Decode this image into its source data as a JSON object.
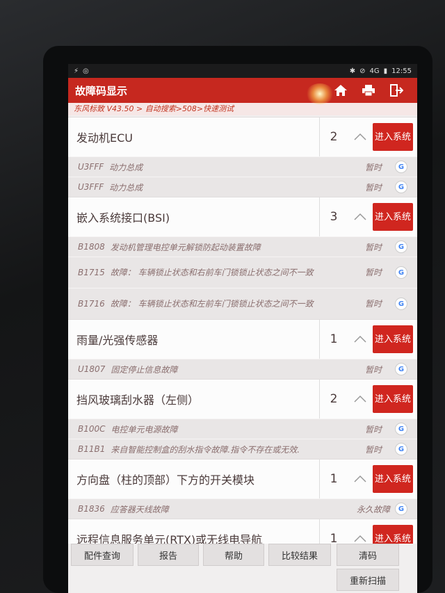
{
  "statusbar": {
    "time": "12:55",
    "signal": "4G"
  },
  "topbar": {
    "title": "故障码显示"
  },
  "breadcrumb": "东风标致 V43.50 > 自动搜索>508>快速测试",
  "systems": [
    {
      "name": "发动机ECU",
      "count": "2",
      "enter_label": "进入系统",
      "dtcs": [
        {
          "code": "U3FFF",
          "desc": "动力总成",
          "status": "暂时"
        },
        {
          "code": "U3FFF",
          "desc": "动力总成",
          "status": "暂时"
        }
      ]
    },
    {
      "name": "嵌入系统接口(BSI)",
      "count": "3",
      "enter_label": "进入系统",
      "dtcs": [
        {
          "code": "B1808",
          "desc": "发动机管理电控单元解锁防起动装置故障",
          "status": "暂时"
        },
        {
          "code": "B1715",
          "desc": "故障： 车辆锁止状态和右前车门锁锁止状态之间不一致",
          "status": "暂时"
        },
        {
          "code": "B1716",
          "desc": "故障： 车辆锁止状态和左前车门锁锁止状态之间不一致",
          "status": "暂时"
        }
      ]
    },
    {
      "name": "雨量/光强传感器",
      "count": "1",
      "enter_label": "进入系统",
      "dtcs": [
        {
          "code": "U1807",
          "desc": "固定停止信息故障",
          "status": "暂时"
        }
      ]
    },
    {
      "name": "挡风玻璃刮水器（左侧）",
      "count": "2",
      "enter_label": "进入系统",
      "dtcs": [
        {
          "code": "B100C",
          "desc": "电控单元电源故障",
          "status": "暂时"
        },
        {
          "code": "B11B1",
          "desc": "来自智能控制盒的刮水指令故障.指令不存在或无效.",
          "status": "暂时"
        }
      ]
    },
    {
      "name": "方向盘（柱的顶部）下方的开关模块",
      "count": "1",
      "enter_label": "进入系统",
      "dtcs": [
        {
          "code": "B1836",
          "desc": "应答器天线故障",
          "status": "永久故障"
        }
      ]
    },
    {
      "name": "远程信息服务单元(RTX)或无线电导航",
      "count": "1",
      "enter_label": "进入系统",
      "dtcs": []
    }
  ],
  "buttons": {
    "parts": "配件查询",
    "report": "报告",
    "help": "帮助",
    "compare": "比较结果",
    "clear": "清码",
    "rescan": "重新扫描"
  }
}
